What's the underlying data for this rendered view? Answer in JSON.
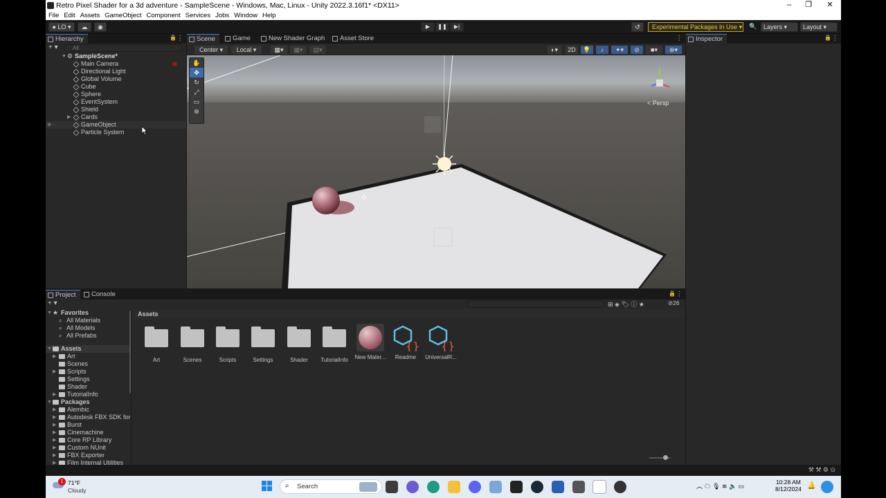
{
  "window": {
    "title": "Retro Pixel Shader for a 3d adventure - SampleScene - Windows, Mac, Linux - Unity 2022.3.16f1* <DX11>"
  },
  "menu": [
    "File",
    "Edit",
    "Assets",
    "GameObject",
    "Component",
    "Services",
    "Jobs",
    "Window",
    "Help"
  ],
  "toolbar": {
    "account": "LO",
    "experimental": "Experimental Packages In Use",
    "layers": "Layers",
    "layout": "Layout"
  },
  "hierarchy": {
    "tab": "Hierarchy",
    "search_placeholder": "All",
    "scene": "SampleScene*",
    "items": [
      "Main Camera",
      "Directional Light",
      "Global Volume",
      "Cube",
      "Sphere",
      "EventSystem",
      "Shield",
      "Cards",
      "GameObject",
      "Particle System"
    ]
  },
  "scene_tabs": [
    "Scene",
    "Game",
    "New Shader Graph",
    "Asset Store"
  ],
  "scene_toolbar": {
    "pivot": "Center",
    "space": "Local",
    "mode2d": "2D",
    "persp": "< Persp"
  },
  "inspector": {
    "tab": "Inspector"
  },
  "project": {
    "tabs": [
      "Project",
      "Console"
    ],
    "favorites_label": "Favorites",
    "favorites": [
      "All Materials",
      "All Models",
      "All Prefabs"
    ],
    "assets_label": "Assets",
    "assets_tree": [
      "Art",
      "Scenes",
      "Scripts",
      "Settings",
      "Shader",
      "TutorialInfo"
    ],
    "packages_label": "Packages",
    "packages": [
      "Alembic",
      "Autodesk FBX SDK for",
      "Burst",
      "Cinemachine",
      "Core RP Library",
      "Custom NUnit",
      "FBX Exporter",
      "Film Internal Utilities"
    ],
    "breadcrumb": "Assets",
    "grid": [
      "Art",
      "Scenes",
      "Scripts",
      "Settings",
      "Shader",
      "TutorialInfo",
      "New Mater...",
      "Readme",
      "UniversalR..."
    ],
    "hidden_count": "26"
  },
  "taskbar": {
    "temp": "71°F",
    "weather": "Cloudy",
    "search": "Search",
    "time": "10:28 AM",
    "date": "8/12/2024",
    "badge": "1"
  }
}
